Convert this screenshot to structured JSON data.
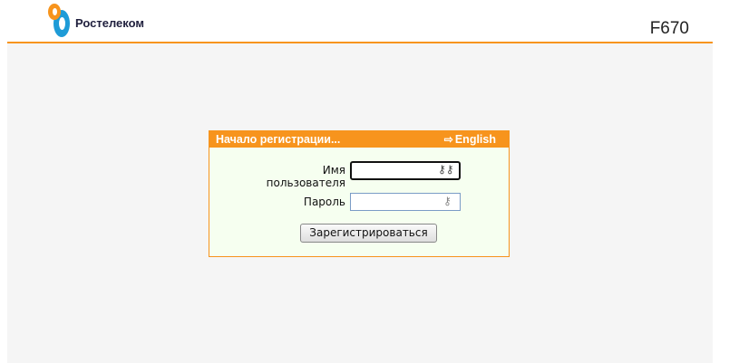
{
  "header": {
    "brand": "Ростелеком",
    "model": "F670"
  },
  "login": {
    "title": "Начало регистрации...",
    "language_link": "English",
    "username_label": "Имя пользователя",
    "username_value": "",
    "password_label": "Пароль",
    "password_value": "",
    "submit_label": "Зарегистрироваться"
  },
  "colors": {
    "accent": "#f7941d",
    "panel_bg": "#f6fff0",
    "logo_blue": "#1e9bd7",
    "logo_orange": "#f7941d"
  }
}
